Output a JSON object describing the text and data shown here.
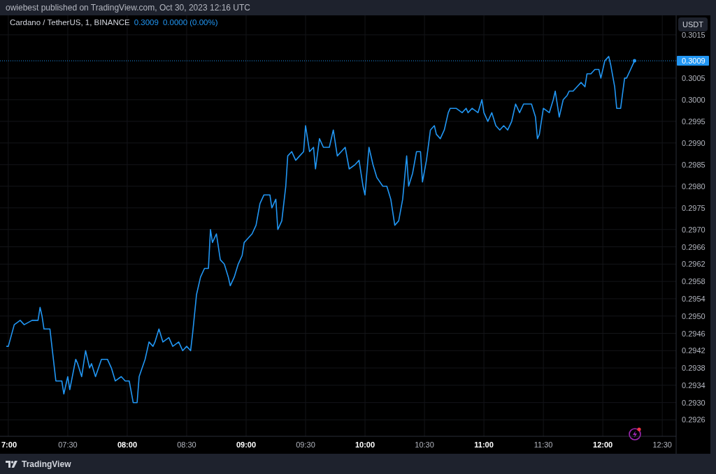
{
  "header": {
    "text": "owiebest published on TradingView.com, Oct 30, 2023 12:16 UTC"
  },
  "legend": {
    "symbol": "Cardano / TetherUS, 1, BINANCE",
    "price": "0.3009",
    "change": "0.0000 (0.00%)"
  },
  "currency_button": "USDT",
  "price_badge": "0.3009",
  "chart_data": {
    "type": "line",
    "grid": true,
    "ref_lines": [
      {
        "axis": "y",
        "value": 0.3009,
        "color": "#2196f3"
      }
    ],
    "x": [
      6.9833,
      7,
      7.05,
      7.1,
      7.1333,
      7.2,
      7.25,
      7.2667,
      7.2833,
      7.3,
      7.35,
      7.4,
      7.45,
      7.4667,
      7.5,
      7.5167,
      7.5667,
      7.5833,
      7.6167,
      7.65,
      7.6833,
      7.7,
      7.7333,
      7.7833,
      7.8333,
      7.8667,
      7.9,
      7.95,
      7.9833,
      8.0167,
      8.05,
      8.0833,
      8.1,
      8.15,
      8.1833,
      8.2167,
      8.2333,
      8.2667,
      8.3,
      8.35,
      8.3833,
      8.4333,
      8.4667,
      8.5,
      8.5333,
      8.55,
      8.5833,
      8.6167,
      8.65,
      8.6833,
      8.7,
      8.7167,
      8.75,
      8.7833,
      8.8167,
      8.85,
      8.8667,
      8.9,
      8.9333,
      8.9667,
      8.9833,
      9.0167,
      9.05,
      9.0833,
      9.1167,
      9.15,
      9.2,
      9.2167,
      9.25,
      9.2667,
      9.3,
      9.3333,
      9.35,
      9.3833,
      9.4167,
      9.45,
      9.4833,
      9.5,
      9.5333,
      9.5667,
      9.5833,
      9.6167,
      9.65,
      9.7,
      9.7333,
      9.7667,
      9.8,
      9.8333,
      9.8667,
      9.9167,
      9.95,
      9.9833,
      10,
      10.0333,
      10.0667,
      10.1,
      10.15,
      10.1833,
      10.2167,
      10.25,
      10.2833,
      10.3167,
      10.35,
      10.3667,
      10.4,
      10.4333,
      10.4667,
      10.4833,
      10.5167,
      10.55,
      10.5833,
      10.6,
      10.6333,
      10.6667,
      10.7,
      10.7167,
      10.7667,
      10.8167,
      10.85,
      10.8667,
      10.9,
      10.95,
      10.9833,
      11,
      11.0333,
      11.0667,
      11.1,
      11.1333,
      11.1667,
      11.2,
      11.2333,
      11.2667,
      11.3,
      11.3333,
      11.3667,
      11.4,
      11.4333,
      11.45,
      11.4667,
      11.5,
      11.55,
      11.5833,
      11.6,
      11.6333,
      11.6667,
      11.7,
      11.7167,
      11.75,
      11.7833,
      11.8167,
      11.85,
      11.8667,
      11.9,
      11.9333,
      11.9667,
      11.9833,
      12.0167,
      12.05,
      12.0667,
      12.1,
      12.1167,
      12.15,
      12.1833,
      12.2,
      12.2333,
      12.25,
      12.2667
    ],
    "series": [
      {
        "color": "#2196f3",
        "values": [
          0.2943,
          0.2943,
          0.2948,
          0.2949,
          0.2948,
          0.2949,
          0.2949,
          0.2952,
          0.295,
          0.2947,
          0.2947,
          0.2935,
          0.2935,
          0.2932,
          0.2936,
          0.2933,
          0.294,
          0.2939,
          0.2936,
          0.2942,
          0.2938,
          0.2939,
          0.2936,
          0.294,
          0.294,
          0.2938,
          0.2935,
          0.2936,
          0.2935,
          0.2935,
          0.293,
          0.293,
          0.2936,
          0.294,
          0.2944,
          0.2943,
          0.2944,
          0.2947,
          0.2944,
          0.2945,
          0.2943,
          0.2944,
          0.2942,
          0.2943,
          0.2942,
          0.2946,
          0.2955,
          0.2959,
          0.2961,
          0.2961,
          0.297,
          0.2967,
          0.2969,
          0.2963,
          0.2962,
          0.2959,
          0.2957,
          0.2959,
          0.2962,
          0.2964,
          0.2967,
          0.2968,
          0.2969,
          0.2971,
          0.2976,
          0.2978,
          0.2978,
          0.2975,
          0.2977,
          0.297,
          0.2972,
          0.298,
          0.2987,
          0.2988,
          0.2986,
          0.2987,
          0.2988,
          0.2994,
          0.2988,
          0.2989,
          0.2984,
          0.2991,
          0.2989,
          0.2989,
          0.2993,
          0.2987,
          0.2988,
          0.2989,
          0.2984,
          0.2985,
          0.2986,
          0.298,
          0.2978,
          0.2989,
          0.2985,
          0.2982,
          0.298,
          0.298,
          0.2977,
          0.2971,
          0.2972,
          0.2977,
          0.2987,
          0.298,
          0.2983,
          0.2988,
          0.2988,
          0.2981,
          0.2986,
          0.2993,
          0.2994,
          0.2992,
          0.2991,
          0.2993,
          0.2997,
          0.2998,
          0.2998,
          0.2997,
          0.2998,
          0.2997,
          0.2998,
          0.2997,
          0.3,
          0.2997,
          0.2995,
          0.2997,
          0.2994,
          0.2993,
          0.2994,
          0.2993,
          0.2995,
          0.2999,
          0.2997,
          0.2999,
          0.2999,
          0.2999,
          0.2996,
          0.2991,
          0.2992,
          0.2998,
          0.2997,
          0.3,
          0.3002,
          0.2996,
          0.3,
          0.3001,
          0.3002,
          0.3002,
          0.3003,
          0.3004,
          0.3003,
          0.3006,
          0.3006,
          0.3007,
          0.3007,
          0.3005,
          0.3009,
          0.301,
          0.3008,
          0.3003,
          0.2998,
          0.2998,
          0.3005,
          0.3005,
          0.3007,
          0.3008,
          0.3009
        ]
      }
    ],
    "xlim": [
      6.93,
      12.6167
    ],
    "ylim": [
      0.29222,
      0.30195
    ],
    "xticks": [
      {
        "value": 7,
        "label": "7:00"
      },
      {
        "value": 7.5,
        "label": "07:30"
      },
      {
        "value": 8,
        "label": "08:00"
      },
      {
        "value": 8.5,
        "label": "08:30"
      },
      {
        "value": 9,
        "label": "09:00"
      },
      {
        "value": 9.5,
        "label": "09:30"
      },
      {
        "value": 10,
        "label": "10:00"
      },
      {
        "value": 10.5,
        "label": "10:30"
      },
      {
        "value": 11,
        "label": "11:00"
      },
      {
        "value": 11.5,
        "label": "11:30"
      },
      {
        "value": 12,
        "label": "12:00"
      },
      {
        "value": 12.5,
        "label": "12:30"
      }
    ],
    "yticks": [
      {
        "value": 0.3015,
        "label": "0.3015"
      },
      {
        "value": 0.3005,
        "label": "0.3005"
      },
      {
        "value": 0.3,
        "label": "0.3000"
      },
      {
        "value": 0.2995,
        "label": "0.2995"
      },
      {
        "value": 0.299,
        "label": "0.2990"
      },
      {
        "value": 0.2985,
        "label": "0.2985"
      },
      {
        "value": 0.298,
        "label": "0.2980"
      },
      {
        "value": 0.2975,
        "label": "0.2975"
      },
      {
        "value": 0.297,
        "label": "0.2970"
      },
      {
        "value": 0.2966,
        "label": "0.2966"
      },
      {
        "value": 0.2962,
        "label": "0.2962"
      },
      {
        "value": 0.2958,
        "label": "0.2958"
      },
      {
        "value": 0.2954,
        "label": "0.2954"
      },
      {
        "value": 0.295,
        "label": "0.2950"
      },
      {
        "value": 0.2946,
        "label": "0.2946"
      },
      {
        "value": 0.2942,
        "label": "0.2942"
      },
      {
        "value": 0.2938,
        "label": "0.2938"
      },
      {
        "value": 0.2934,
        "label": "0.2934"
      },
      {
        "value": 0.293,
        "label": "0.2930"
      },
      {
        "value": 0.2926,
        "label": "0.2926"
      }
    ]
  },
  "footer": {
    "brand": "TradingView"
  }
}
